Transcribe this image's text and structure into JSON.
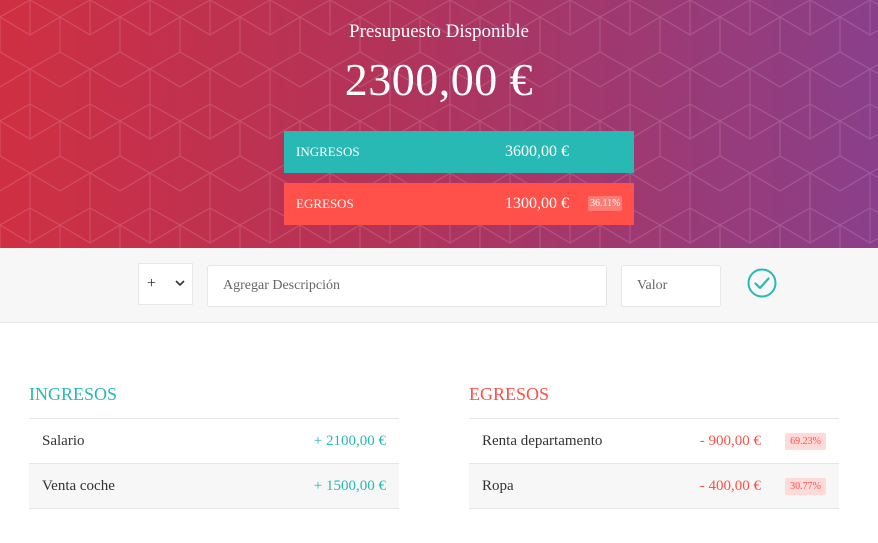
{
  "header": {
    "title": "Presupuesto Disponible",
    "available": "2300,00 €",
    "income": {
      "label": "INGRESOS",
      "value": "3600,00 €"
    },
    "expense": {
      "label": "EGRESOS",
      "value": "1300,00 €",
      "percentage": "36.11%"
    }
  },
  "add_bar": {
    "type_selected": "+",
    "description_placeholder": "Agregar Descripción",
    "value_placeholder": "Valor",
    "add_icon": "check-circle-icon"
  },
  "income_list": {
    "title": "INGRESOS",
    "items": [
      {
        "description": "Salario",
        "value": "+ 2100,00 €"
      },
      {
        "description": "Venta coche",
        "value": "+ 1500,00 €"
      }
    ]
  },
  "expense_list": {
    "title": "EGRESOS",
    "items": [
      {
        "description": "Renta departamento",
        "value": "- 900,00 €",
        "percentage": "69.23%"
      },
      {
        "description": "Ropa",
        "value": "- 400,00 €",
        "percentage": "30.77%"
      }
    ]
  },
  "colors": {
    "income": "#28b9b5",
    "expense": "#ff5049",
    "gradient_start": "#cf2f42",
    "gradient_end": "#8a3f8a"
  }
}
